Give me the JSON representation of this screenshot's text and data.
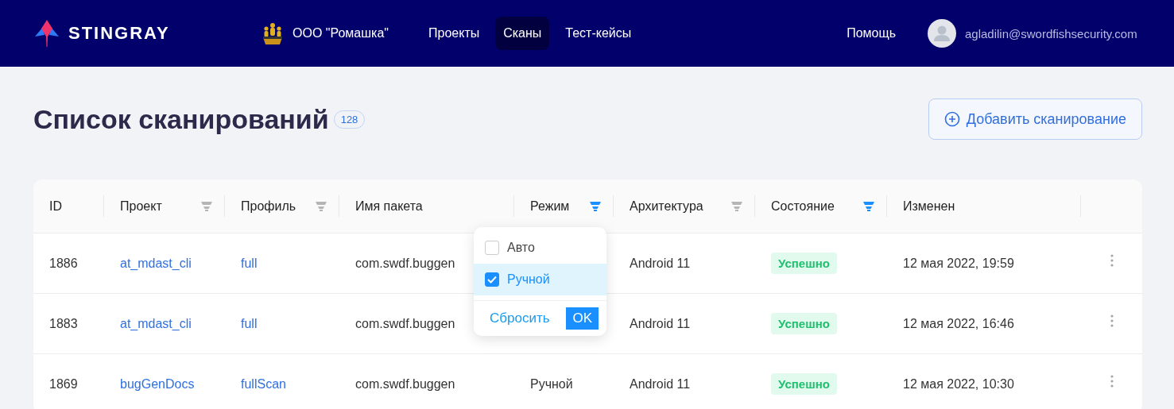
{
  "header": {
    "logo": "STINGRAY",
    "organization": "ООО \"Ромашка\"",
    "nav": [
      {
        "label": "Проекты",
        "selected": false
      },
      {
        "label": "Сканы",
        "selected": true
      },
      {
        "label": "Тест-кейсы",
        "selected": false
      }
    ],
    "help": "Помощь",
    "user_email": "agladilin@swordfishsecurity.com"
  },
  "page": {
    "title": "Список сканирований",
    "count": "128",
    "add_button": "Добавить сканирование"
  },
  "table": {
    "columns": [
      {
        "label": "ID"
      },
      {
        "label": "Проект",
        "filtered": false
      },
      {
        "label": "Профиль",
        "filtered": false
      },
      {
        "label": "Имя пакета"
      },
      {
        "label": "Режим",
        "filtered": true
      },
      {
        "label": "Архитектура",
        "filtered": false
      },
      {
        "label": "Состояние",
        "filtered": true
      },
      {
        "label": "Изменен"
      }
    ],
    "rows": [
      {
        "id": "1886",
        "project": "at_mdast_cli",
        "profile": "full",
        "package": "com.swdf.buggen",
        "architecture": "Android 11",
        "status": "Успешно",
        "modified": "12 мая 2022, 19:59"
      },
      {
        "id": "1883",
        "project": "at_mdast_cli",
        "profile": "full",
        "package": "com.swdf.buggen",
        "architecture": "Android 11",
        "status": "Успешно",
        "modified": "12 мая 2022, 16:46"
      },
      {
        "id": "1869",
        "project": "bugGenDocs",
        "profile": "fullScan",
        "package": "com.swdf.buggen",
        "mode": "Ручной",
        "architecture": "Android 11",
        "status": "Успешно",
        "modified": "12 мая 2022, 10:30"
      }
    ]
  },
  "filter_dropdown": {
    "options": [
      {
        "label": "Авто",
        "checked": false
      },
      {
        "label": "Ручной",
        "checked": true
      }
    ],
    "reset": "Сбросить",
    "ok": "OK"
  }
}
